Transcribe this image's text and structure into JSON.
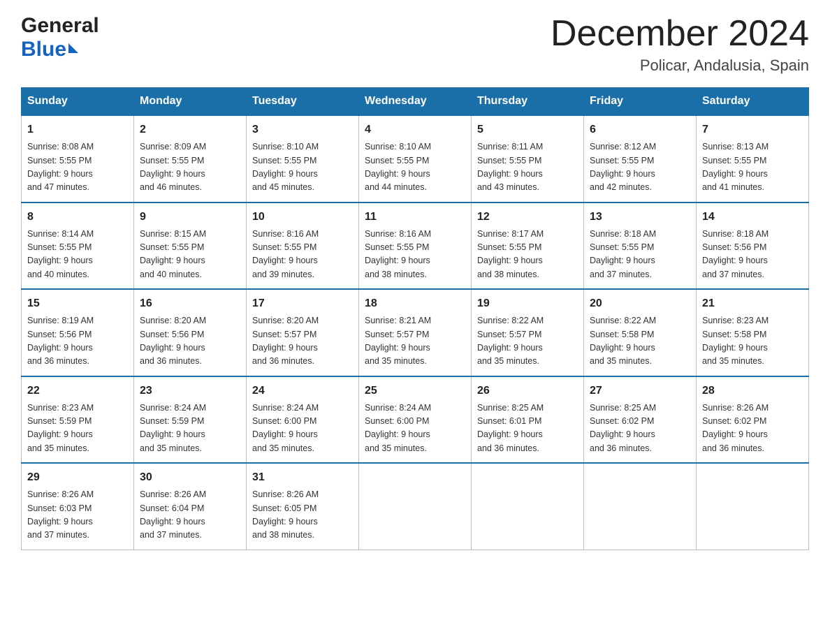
{
  "header": {
    "logo_general": "General",
    "logo_blue": "Blue",
    "month_title": "December 2024",
    "location": "Policar, Andalusia, Spain"
  },
  "days_of_week": [
    "Sunday",
    "Monday",
    "Tuesday",
    "Wednesday",
    "Thursday",
    "Friday",
    "Saturday"
  ],
  "weeks": [
    [
      {
        "day": "1",
        "sunrise": "Sunrise: 8:08 AM",
        "sunset": "Sunset: 5:55 PM",
        "daylight": "Daylight: 9 hours",
        "daylight2": "and 47 minutes."
      },
      {
        "day": "2",
        "sunrise": "Sunrise: 8:09 AM",
        "sunset": "Sunset: 5:55 PM",
        "daylight": "Daylight: 9 hours",
        "daylight2": "and 46 minutes."
      },
      {
        "day": "3",
        "sunrise": "Sunrise: 8:10 AM",
        "sunset": "Sunset: 5:55 PM",
        "daylight": "Daylight: 9 hours",
        "daylight2": "and 45 minutes."
      },
      {
        "day": "4",
        "sunrise": "Sunrise: 8:10 AM",
        "sunset": "Sunset: 5:55 PM",
        "daylight": "Daylight: 9 hours",
        "daylight2": "and 44 minutes."
      },
      {
        "day": "5",
        "sunrise": "Sunrise: 8:11 AM",
        "sunset": "Sunset: 5:55 PM",
        "daylight": "Daylight: 9 hours",
        "daylight2": "and 43 minutes."
      },
      {
        "day": "6",
        "sunrise": "Sunrise: 8:12 AM",
        "sunset": "Sunset: 5:55 PM",
        "daylight": "Daylight: 9 hours",
        "daylight2": "and 42 minutes."
      },
      {
        "day": "7",
        "sunrise": "Sunrise: 8:13 AM",
        "sunset": "Sunset: 5:55 PM",
        "daylight": "Daylight: 9 hours",
        "daylight2": "and 41 minutes."
      }
    ],
    [
      {
        "day": "8",
        "sunrise": "Sunrise: 8:14 AM",
        "sunset": "Sunset: 5:55 PM",
        "daylight": "Daylight: 9 hours",
        "daylight2": "and 40 minutes."
      },
      {
        "day": "9",
        "sunrise": "Sunrise: 8:15 AM",
        "sunset": "Sunset: 5:55 PM",
        "daylight": "Daylight: 9 hours",
        "daylight2": "and 40 minutes."
      },
      {
        "day": "10",
        "sunrise": "Sunrise: 8:16 AM",
        "sunset": "Sunset: 5:55 PM",
        "daylight": "Daylight: 9 hours",
        "daylight2": "and 39 minutes."
      },
      {
        "day": "11",
        "sunrise": "Sunrise: 8:16 AM",
        "sunset": "Sunset: 5:55 PM",
        "daylight": "Daylight: 9 hours",
        "daylight2": "and 38 minutes."
      },
      {
        "day": "12",
        "sunrise": "Sunrise: 8:17 AM",
        "sunset": "Sunset: 5:55 PM",
        "daylight": "Daylight: 9 hours",
        "daylight2": "and 38 minutes."
      },
      {
        "day": "13",
        "sunrise": "Sunrise: 8:18 AM",
        "sunset": "Sunset: 5:55 PM",
        "daylight": "Daylight: 9 hours",
        "daylight2": "and 37 minutes."
      },
      {
        "day": "14",
        "sunrise": "Sunrise: 8:18 AM",
        "sunset": "Sunset: 5:56 PM",
        "daylight": "Daylight: 9 hours",
        "daylight2": "and 37 minutes."
      }
    ],
    [
      {
        "day": "15",
        "sunrise": "Sunrise: 8:19 AM",
        "sunset": "Sunset: 5:56 PM",
        "daylight": "Daylight: 9 hours",
        "daylight2": "and 36 minutes."
      },
      {
        "day": "16",
        "sunrise": "Sunrise: 8:20 AM",
        "sunset": "Sunset: 5:56 PM",
        "daylight": "Daylight: 9 hours",
        "daylight2": "and 36 minutes."
      },
      {
        "day": "17",
        "sunrise": "Sunrise: 8:20 AM",
        "sunset": "Sunset: 5:57 PM",
        "daylight": "Daylight: 9 hours",
        "daylight2": "and 36 minutes."
      },
      {
        "day": "18",
        "sunrise": "Sunrise: 8:21 AM",
        "sunset": "Sunset: 5:57 PM",
        "daylight": "Daylight: 9 hours",
        "daylight2": "and 35 minutes."
      },
      {
        "day": "19",
        "sunrise": "Sunrise: 8:22 AM",
        "sunset": "Sunset: 5:57 PM",
        "daylight": "Daylight: 9 hours",
        "daylight2": "and 35 minutes."
      },
      {
        "day": "20",
        "sunrise": "Sunrise: 8:22 AM",
        "sunset": "Sunset: 5:58 PM",
        "daylight": "Daylight: 9 hours",
        "daylight2": "and 35 minutes."
      },
      {
        "day": "21",
        "sunrise": "Sunrise: 8:23 AM",
        "sunset": "Sunset: 5:58 PM",
        "daylight": "Daylight: 9 hours",
        "daylight2": "and 35 minutes."
      }
    ],
    [
      {
        "day": "22",
        "sunrise": "Sunrise: 8:23 AM",
        "sunset": "Sunset: 5:59 PM",
        "daylight": "Daylight: 9 hours",
        "daylight2": "and 35 minutes."
      },
      {
        "day": "23",
        "sunrise": "Sunrise: 8:24 AM",
        "sunset": "Sunset: 5:59 PM",
        "daylight": "Daylight: 9 hours",
        "daylight2": "and 35 minutes."
      },
      {
        "day": "24",
        "sunrise": "Sunrise: 8:24 AM",
        "sunset": "Sunset: 6:00 PM",
        "daylight": "Daylight: 9 hours",
        "daylight2": "and 35 minutes."
      },
      {
        "day": "25",
        "sunrise": "Sunrise: 8:24 AM",
        "sunset": "Sunset: 6:00 PM",
        "daylight": "Daylight: 9 hours",
        "daylight2": "and 35 minutes."
      },
      {
        "day": "26",
        "sunrise": "Sunrise: 8:25 AM",
        "sunset": "Sunset: 6:01 PM",
        "daylight": "Daylight: 9 hours",
        "daylight2": "and 36 minutes."
      },
      {
        "day": "27",
        "sunrise": "Sunrise: 8:25 AM",
        "sunset": "Sunset: 6:02 PM",
        "daylight": "Daylight: 9 hours",
        "daylight2": "and 36 minutes."
      },
      {
        "day": "28",
        "sunrise": "Sunrise: 8:26 AM",
        "sunset": "Sunset: 6:02 PM",
        "daylight": "Daylight: 9 hours",
        "daylight2": "and 36 minutes."
      }
    ],
    [
      {
        "day": "29",
        "sunrise": "Sunrise: 8:26 AM",
        "sunset": "Sunset: 6:03 PM",
        "daylight": "Daylight: 9 hours",
        "daylight2": "and 37 minutes."
      },
      {
        "day": "30",
        "sunrise": "Sunrise: 8:26 AM",
        "sunset": "Sunset: 6:04 PM",
        "daylight": "Daylight: 9 hours",
        "daylight2": "and 37 minutes."
      },
      {
        "day": "31",
        "sunrise": "Sunrise: 8:26 AM",
        "sunset": "Sunset: 6:05 PM",
        "daylight": "Daylight: 9 hours",
        "daylight2": "and 38 minutes."
      },
      null,
      null,
      null,
      null
    ]
  ]
}
